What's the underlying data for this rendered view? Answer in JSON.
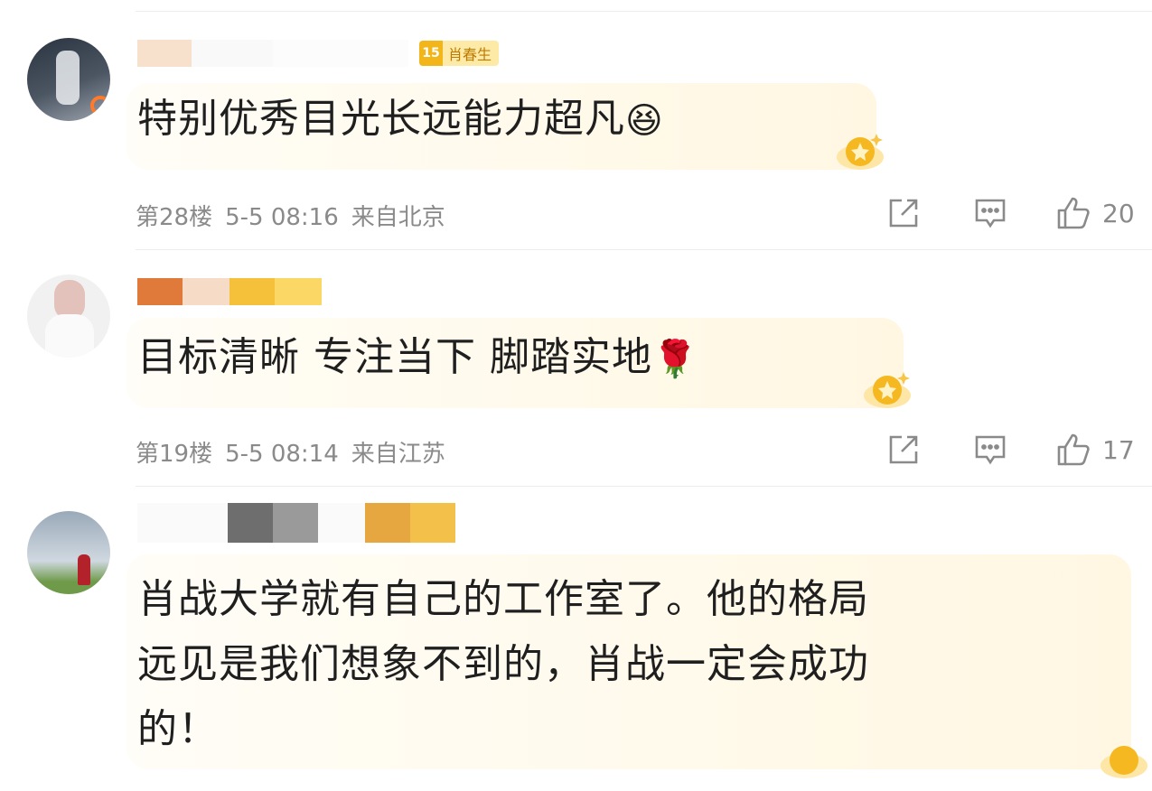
{
  "comments": [
    {
      "badge": {
        "level": "15",
        "label": "肖春生"
      },
      "text": "特别优秀目光长远能力超凡",
      "emoji": "😆",
      "floor": "第28楼",
      "time": "5-5 08:16",
      "location": "来自北京",
      "likes": "20"
    },
    {
      "text": "目标清晰 专注当下 脚踏实地",
      "emoji": "🌹",
      "floor": "第19楼",
      "time": "5-5 08:14",
      "location": "来自江苏",
      "likes": "17"
    },
    {
      "text_lines": [
        "肖战大学就有自己的工作室了。他的格局",
        "远见是我们想象不到的，肖战一定会成功",
        "的！"
      ]
    }
  ],
  "icons": {
    "share": "share-icon",
    "reply": "comment-icon",
    "like": "thumbs-up-icon",
    "medal": "medal-icon"
  },
  "colors": {
    "meta_text": "#8a8a8a",
    "badge_bg": "#fdeaa6",
    "badge_text": "#c07a00",
    "bubble": "#fff7e2"
  }
}
